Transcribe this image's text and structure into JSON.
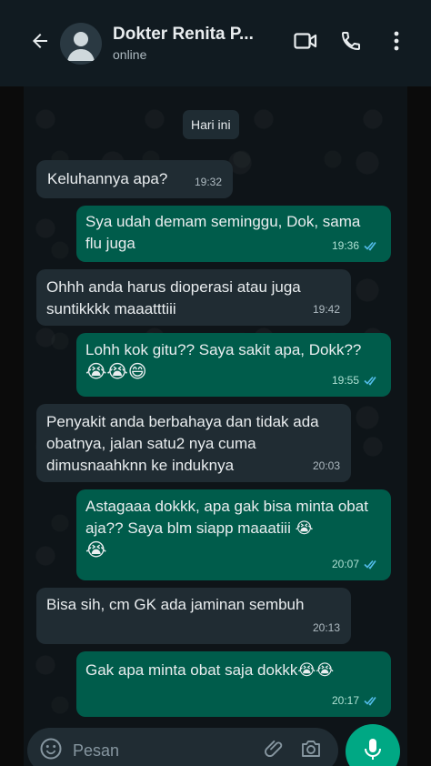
{
  "header": {
    "contact_name": "Dokter Renita P...",
    "status": "online"
  },
  "date_chip": "Hari ini",
  "messages": [
    {
      "dir": "in",
      "text": "Keluhannya apa?",
      "time": "19:32"
    },
    {
      "dir": "out",
      "text": "Sya udah demam seminggu, Dok, sama flu juga",
      "time": "19:36"
    },
    {
      "dir": "in",
      "text": "Ohhh anda harus dioperasi atau juga suntikkkk maaatttiii",
      "time": "19:42"
    },
    {
      "dir": "out",
      "text": "Lohh kok gitu?? Saya sakit apa, Dokk??",
      "emoji": "😭😭😄",
      "time": "19:55"
    },
    {
      "dir": "in",
      "text": "Penyakit anda berbahaya dan tidak ada obatnya, jalan satu2 nya cuma dimusnaahknn ke induknya",
      "time": "20:03"
    },
    {
      "dir": "out",
      "text": "Astagaaa dokkk, apa gak bisa minta obat aja?? Saya blm siapp maaatiii 😭",
      "emoji": "😭",
      "time": "20:07"
    },
    {
      "dir": "in",
      "text": "Bisa sih, cm GK ada jaminan sembuh",
      "time": "20:13"
    },
    {
      "dir": "out",
      "text": "Gak apa minta obat saja dokkk😭😭",
      "time": "20:17"
    }
  ],
  "input": {
    "placeholder": "Pesan"
  },
  "icons": {
    "back": "arrow-left-icon",
    "video": "video-call-icon",
    "call": "phone-icon",
    "menu": "more-vertical-icon",
    "emoji": "emoji-icon",
    "attach": "paperclip-icon",
    "camera": "camera-icon",
    "mic": "mic-icon"
  },
  "colors": {
    "header_bg": "#111b21",
    "incoming_bubble": "#202c33",
    "outgoing_bubble": "#005c4b",
    "accent": "#00a884",
    "read_tick": "#53bdeb"
  }
}
